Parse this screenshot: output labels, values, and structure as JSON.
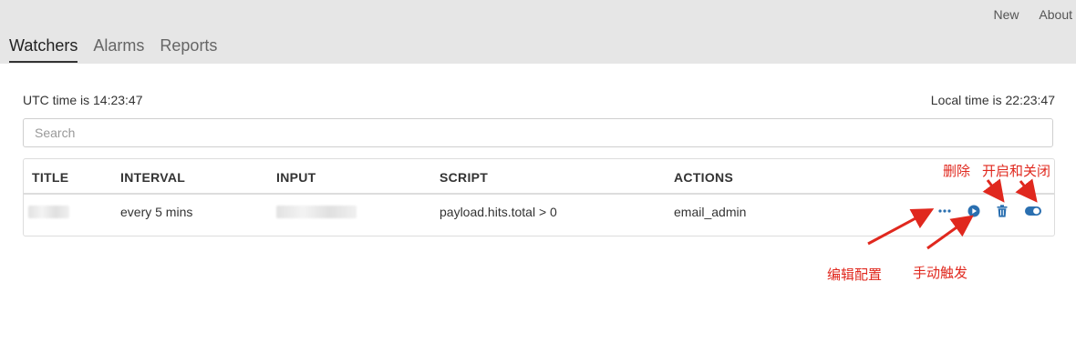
{
  "header": {
    "links": [
      "New",
      "About"
    ],
    "tabs": [
      {
        "label": "Watchers",
        "active": true
      },
      {
        "label": "Alarms",
        "active": false
      },
      {
        "label": "Reports",
        "active": false
      }
    ]
  },
  "times": {
    "utc": "UTC time is 14:23:47",
    "local": "Local time is 22:23:47"
  },
  "search": {
    "placeholder": "Search",
    "value": ""
  },
  "table": {
    "columns": [
      "TITLE",
      "INTERVAL",
      "INPUT",
      "SCRIPT",
      "ACTIONS"
    ],
    "rows": [
      {
        "title": "",
        "interval": "every 5 mins",
        "input": "",
        "script": "payload.hits.total > 0",
        "actions": "email_admin"
      }
    ]
  },
  "row_actions": [
    {
      "icon": "ellipsis-icon"
    },
    {
      "icon": "play-icon"
    },
    {
      "icon": "trash-icon"
    },
    {
      "icon": "toggle-icon"
    }
  ],
  "annotations": {
    "delete": "删除",
    "toggle": "开启和关闭",
    "edit": "编辑配置",
    "trigger": "手动触发"
  },
  "colors": {
    "header_bg": "#e6e6e6",
    "accent": "#2a6fb0",
    "annotation": "#e0281e"
  }
}
